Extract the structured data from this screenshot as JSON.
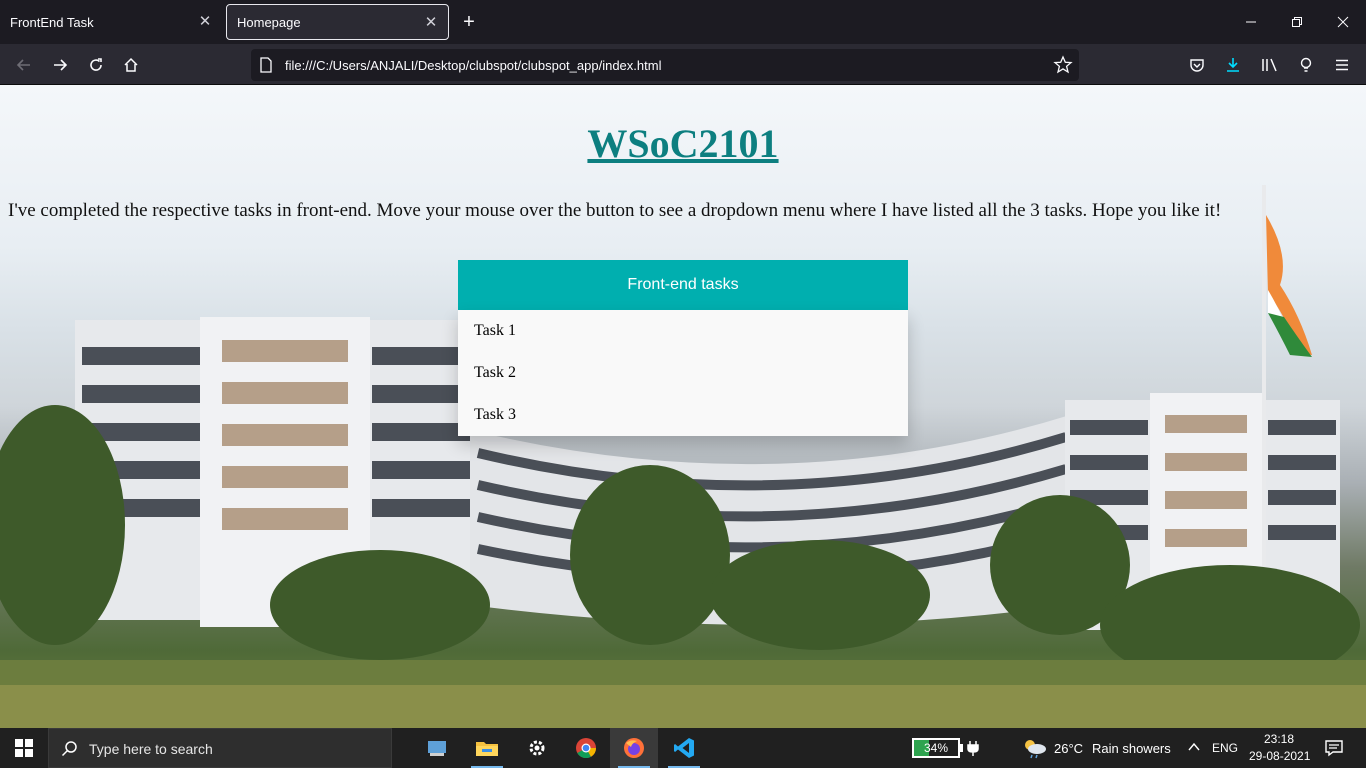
{
  "browser": {
    "tabs": [
      {
        "title": "FrontEnd Task",
        "active": false
      },
      {
        "title": "Homepage",
        "active": true
      }
    ],
    "url": "file:///C:/Users/ANJALI/Desktop/clubspot/clubspot_app/index.html"
  },
  "page": {
    "title": "WSoC2101",
    "intro": "I've completed the respective tasks in front-end. Move your mouse over the button to see a dropdown menu where I have listed all the 3 tasks. Hope you like it!",
    "dropdown_button": "Front-end tasks",
    "dropdown_items": [
      "Task 1",
      "Task 2",
      "Task 3"
    ],
    "colors": {
      "title": "#0d7f80",
      "button": "#00afaf",
      "menu": "#f9f9f9"
    }
  },
  "taskbar": {
    "search_placeholder": "Type here to search",
    "apps": [
      "task-view-icon",
      "file-explorer-icon",
      "settings-icon",
      "chrome-icon",
      "firefox-icon",
      "vscode-icon"
    ],
    "battery_percent": "34%",
    "battery_level": 0.34,
    "weather": {
      "temp": "26°C",
      "condition": "Rain showers"
    },
    "language": "ENG",
    "time": "23:18",
    "date": "29-08-2021"
  }
}
